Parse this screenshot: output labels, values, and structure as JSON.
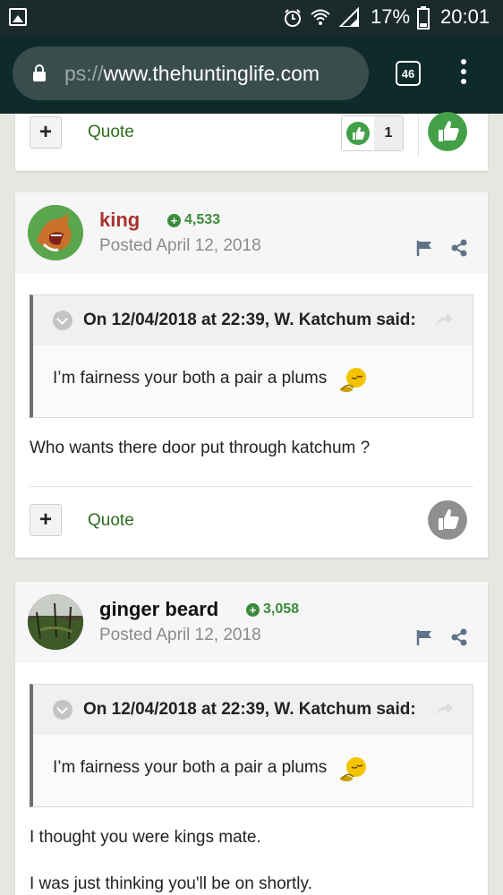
{
  "status_bar": {
    "battery": "17%",
    "time": "20:01",
    "icons": [
      "image-icon",
      "alarm-icon",
      "wifi-icon",
      "signal-icon",
      "battery-icon"
    ]
  },
  "browser": {
    "url_prefix": "ps://",
    "url_host": "www.thehuntinglife.com",
    "tab_count": "46",
    "icons": [
      "lock-icon",
      "menu-dots-icon"
    ]
  },
  "top_actions": {
    "quote_label": "Quote",
    "like_count": "1",
    "plus_label": "+"
  },
  "posts": [
    {
      "author": "king",
      "author_color": "#a8322e",
      "reputation": "4,533",
      "posted": "Posted April 12, 2018",
      "quote_title": "On 12/04/2018 at 22:39, W. Katchum said:",
      "quote_body": "I’m fairness your both a pair a plums",
      "body": [
        "Who wants there door put through katchum ?"
      ],
      "quote_label": "Quote",
      "plus_label": "+"
    },
    {
      "author": "ginger beard",
      "author_color": "#111111",
      "reputation": "3,058",
      "posted": "Posted April 12, 2018",
      "quote_title": "On 12/04/2018 at 22:39, W. Katchum said:",
      "quote_body": "I’m fairness your both a pair a plums",
      "body": [
        "I thought you were kings mate.",
        "I was just thinking you'll be on shortly."
      ]
    }
  ],
  "colors": {
    "accent_green": "#3a8a3a",
    "quote_link": "#2e6e1e",
    "like_green": "#43a047"
  }
}
